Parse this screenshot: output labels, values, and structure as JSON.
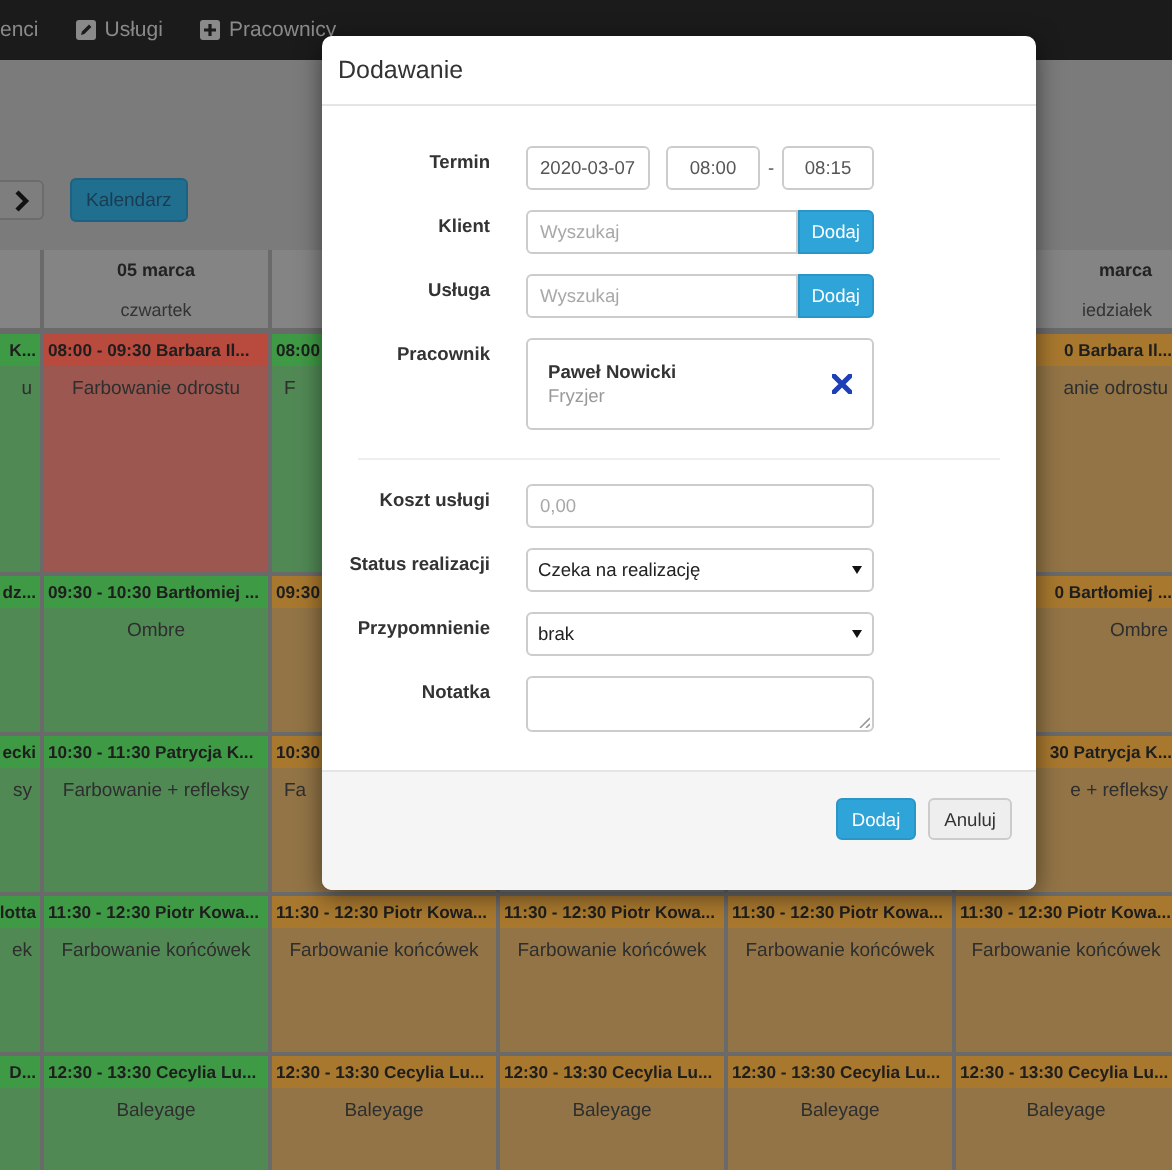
{
  "nav": {
    "items": [
      {
        "label": "enci"
      },
      {
        "label": "Usługi"
      },
      {
        "label": "Pracownicy"
      }
    ]
  },
  "toolbar": {
    "calendar_button": "Kalendarz"
  },
  "calendar": {
    "columns": [
      {
        "cells": [
          {
            "kind": "right-part",
            "color": "#3f9a45",
            "time": "K...",
            "service": "u"
          },
          {
            "kind": "right-part",
            "color": "#3f9a45",
            "time": "dz..."
          },
          {
            "kind": "right-part",
            "color": "#3f9a45",
            "time": "ecki",
            "service": "sy"
          },
          {
            "kind": "right-part",
            "color": "#3f9a45",
            "time": "lotta",
            "service": "ek"
          },
          {
            "kind": "right-part",
            "color": "#3f9a45",
            "time": "D..."
          }
        ]
      },
      {
        "header": {
          "kind": "full",
          "date": "05 marca",
          "day": "czwartek"
        },
        "cells": [
          {
            "kind": "full",
            "color": "#b84a3e",
            "time": "08:00 - 09:30 Barbara Il...",
            "service": "Farbowanie odrostu"
          },
          {
            "kind": "full",
            "color": "#3f9a45",
            "time": "09:30 - 10:30 Bartłomiej ...",
            "service": "Ombre"
          },
          {
            "kind": "full",
            "color": "#3f9a45",
            "time": "10:30 - 11:30 Patrycja K...",
            "service": "Farbowanie + refleksy"
          },
          {
            "kind": "full",
            "color": "#3f9a45",
            "time": "11:30 - 12:30 Piotr Kowa...",
            "service": "Farbowanie końcówek"
          },
          {
            "kind": "full",
            "color": "#3f9a45",
            "time": "12:30 - 13:30 Cecylia Lu...",
            "service": "Baleyage"
          }
        ]
      },
      {
        "cells": [
          {
            "kind": "left-part",
            "color": "#3f9a45",
            "time": "08:00",
            "service": "F"
          },
          {
            "kind": "left-part",
            "color": "#a8782e",
            "time": "09:30"
          },
          {
            "kind": "left-part",
            "color": "#a8782e",
            "time": "10:30",
            "service": "Fa"
          },
          {
            "kind": "full",
            "color": "#a8782e",
            "time": "11:30 - 12:30 Piotr Kowa...",
            "service": "Farbowanie końcówek"
          },
          {
            "kind": "full",
            "color": "#a8782e",
            "time": "12:30 - 13:30 Cecylia Lu...",
            "service": "Baleyage"
          }
        ]
      },
      {
        "cells": [
          null,
          null,
          null,
          {
            "kind": "full",
            "color": "#a8782e",
            "time": "11:30 - 12:30 Piotr Kowa...",
            "service": "Farbowanie końcówek"
          },
          {
            "kind": "full",
            "color": "#a8782e",
            "time": "12:30 - 13:30 Cecylia Lu...",
            "service": "Baleyage"
          }
        ]
      },
      {
        "cells": [
          null,
          null,
          null,
          {
            "kind": "full",
            "color": "#a8782e",
            "time": "11:30 - 12:30 Piotr Kowa...",
            "service": "Farbowanie końcówek"
          },
          {
            "kind": "full",
            "color": "#a8782e",
            "time": "12:30 - 13:30 Cecylia Lu...",
            "service": "Baleyage"
          }
        ]
      },
      {
        "header": {
          "kind": "right-part",
          "date": "marca",
          "day": "iedziałek"
        },
        "cells": [
          {
            "kind": "right-part",
            "color": "#a8782e",
            "time": "0 Barbara Il...",
            "service": "anie odrostu"
          },
          {
            "kind": "right-part",
            "color": "#a8782e",
            "time": "0 Bartłomiej ...",
            "service": "Ombre"
          },
          {
            "kind": "right-part",
            "color": "#a8782e",
            "time": "30 Patrycja K...",
            "service": "e + refleksy"
          },
          {
            "kind": "full",
            "color": "#a8782e",
            "time": "11:30 - 12:30 Piotr Kowa...",
            "service": "Farbowanie końcówek"
          },
          {
            "kind": "full",
            "color": "#a8782e",
            "time": "12:30 - 13:30 Cecylia Lu...",
            "service": "Baleyage"
          }
        ]
      }
    ]
  },
  "dialog": {
    "title": "Dodawanie",
    "groups": [
      [
        {
          "kind": "datetime",
          "label": "Termin",
          "date": "2020-03-07",
          "start": "08:00",
          "separator": "-",
          "end": "08:15"
        },
        {
          "kind": "search",
          "label": "Klient",
          "placeholder": "Wyszukaj",
          "button": "Dodaj"
        },
        {
          "kind": "search",
          "label": "Usługa",
          "placeholder": "Wyszukaj",
          "button": "Dodaj"
        },
        {
          "kind": "person",
          "label": "Pracownik",
          "name": "Paweł Nowicki",
          "role": "Fryzjer"
        }
      ],
      [
        {
          "kind": "text",
          "label": "Koszt usługi",
          "placeholder": "0,00"
        },
        {
          "kind": "select",
          "label": "Status realizacji",
          "value": "Czeka na realizację"
        },
        {
          "kind": "select",
          "label": "Przypomnienie",
          "value": "brak"
        },
        {
          "kind": "textarea",
          "label": "Notatka"
        }
      ]
    ],
    "buttons": [
      {
        "label": "Dodaj",
        "kind": "primary"
      },
      {
        "label": "Anuluj",
        "kind": "default"
      }
    ]
  }
}
